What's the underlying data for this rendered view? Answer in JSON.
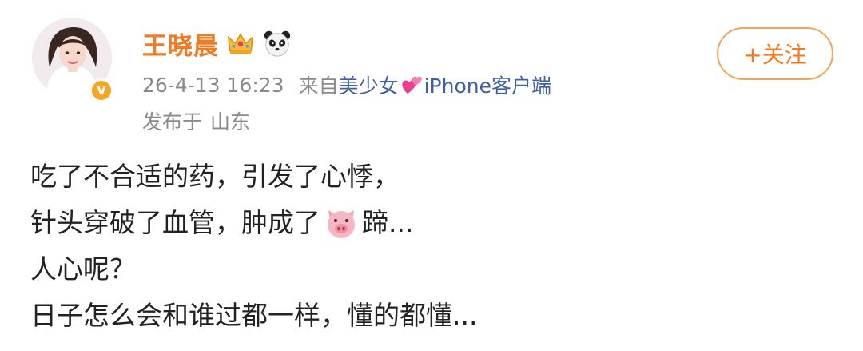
{
  "post": {
    "author": {
      "name": "王晓晨",
      "badge_label": "v",
      "name_icons": [
        "crown-emoji-icon",
        "panda-emoji-icon"
      ]
    },
    "meta": {
      "time": "26-4-13 16:23",
      "source_prefix": "来自",
      "source_text_1": "美少女",
      "source_icon": "pink-hearts-emoji-icon",
      "source_text_2": "iPhone客户端"
    },
    "location": {
      "prefix": "发布于",
      "place": "山东"
    },
    "follow_label": "+关注",
    "content": {
      "line1": "吃了不合适的药，引发了心悸，",
      "line2_before": "针头穿破了血管，肿成了",
      "line2_icon": "pig-face-emoji-icon",
      "line2_after": "蹄...",
      "line3": "人心呢？",
      "line4": "日子怎么会和谁过都一样，懂的都懂..."
    }
  },
  "colors": {
    "username": "#f47a20",
    "follow_border": "#f3a45b",
    "meta_text": "#8a8a8a",
    "source_link": "#3f5fa8",
    "badge": "#f5a623",
    "body_text": "#222222"
  }
}
